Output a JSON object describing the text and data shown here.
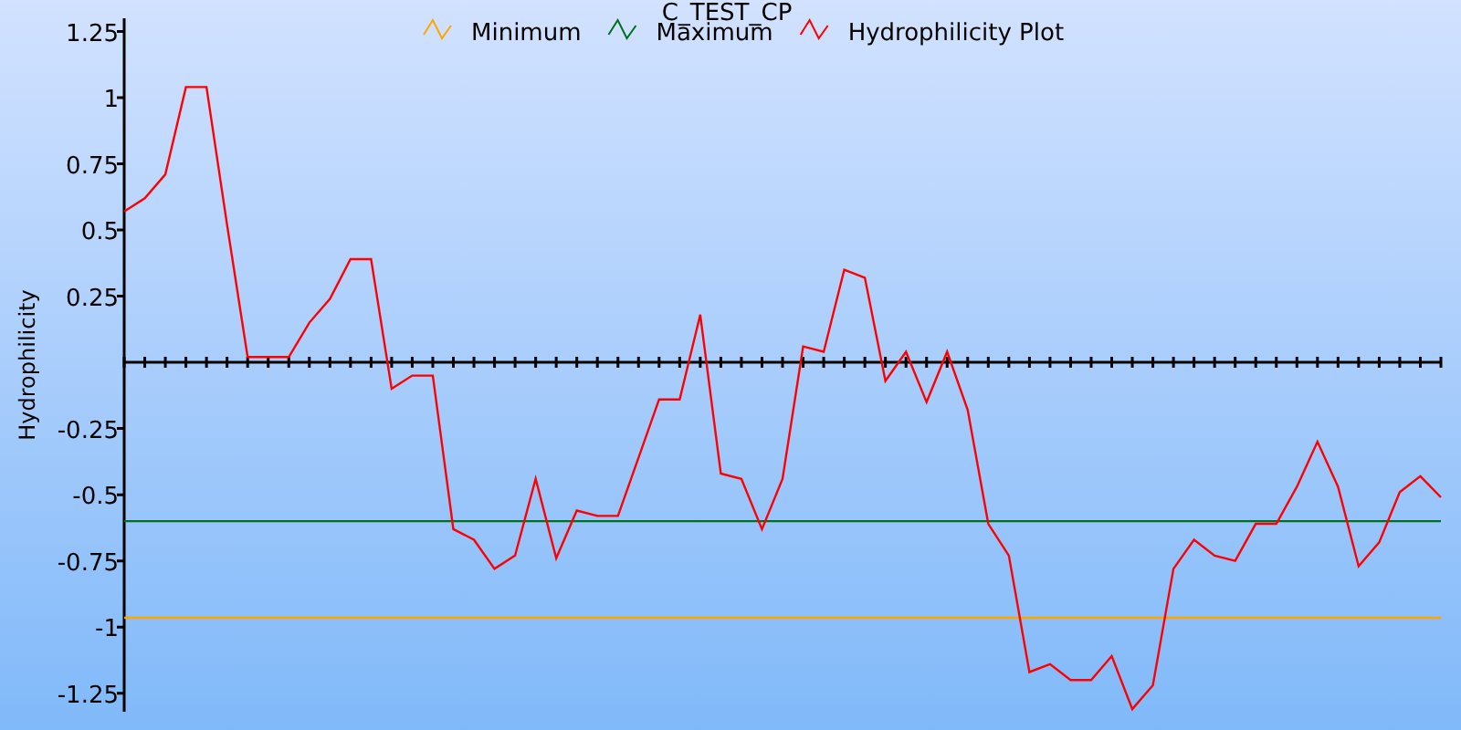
{
  "chart": {
    "chart_data": {
      "type": "line",
      "title": "C_TEST_CP",
      "ylabel": "Hydrophilicity",
      "legend": true,
      "ylim": [
        -1.32,
        1.3
      ],
      "yticks": [
        {
          "value": 1.25,
          "label": "1.25"
        },
        {
          "value": 1,
          "label": "1"
        },
        {
          "value": 0.75,
          "label": "0.75"
        },
        {
          "value": 0.5,
          "label": "0.5"
        },
        {
          "value": 0.25,
          "label": "0.25"
        },
        {
          "value": -0.25,
          "label": "-0.25"
        },
        {
          "value": -0.5,
          "label": "-0.5"
        },
        {
          "value": -0.75,
          "label": "-0.75"
        },
        {
          "value": -1,
          "label": "-1"
        },
        {
          "value": -1.25,
          "label": "-1.25"
        }
      ],
      "series": [
        {
          "name": "Minimum",
          "color": "#ffa500",
          "values": [
            -0.965,
            -0.965,
            -0.965,
            -0.965,
            -0.965,
            -0.965,
            -0.965,
            -0.965,
            -0.965,
            -0.965,
            -0.965,
            -0.965,
            -0.965,
            -0.965,
            -0.965,
            -0.965,
            -0.965,
            -0.965,
            -0.965,
            -0.965,
            -0.965,
            -0.965,
            -0.965,
            -0.965,
            -0.965,
            -0.965,
            -0.965,
            -0.965,
            -0.965,
            -0.965,
            -0.965,
            -0.965,
            -0.965,
            -0.965,
            -0.965,
            -0.965,
            -0.965,
            -0.965,
            -0.965,
            -0.965,
            -0.965,
            -0.965,
            -0.965,
            -0.965,
            -0.965,
            -0.965,
            -0.965,
            -0.965,
            -0.965,
            -0.965,
            -0.965,
            -0.965,
            -0.965,
            -0.965,
            -0.965,
            -0.965,
            -0.965,
            -0.965,
            -0.965,
            -0.965,
            -0.965,
            -0.965,
            -0.965,
            -0.965,
            -0.965
          ]
        },
        {
          "name": "Maximum",
          "color": "#007020",
          "values": [
            -0.6,
            -0.6,
            -0.6,
            -0.6,
            -0.6,
            -0.6,
            -0.6,
            -0.6,
            -0.6,
            -0.6,
            -0.6,
            -0.6,
            -0.6,
            -0.6,
            -0.6,
            -0.6,
            -0.6,
            -0.6,
            -0.6,
            -0.6,
            -0.6,
            -0.6,
            -0.6,
            -0.6,
            -0.6,
            -0.6,
            -0.6,
            -0.6,
            -0.6,
            -0.6,
            -0.6,
            -0.6,
            -0.6,
            -0.6,
            -0.6,
            -0.6,
            -0.6,
            -0.6,
            -0.6,
            -0.6,
            -0.6,
            -0.6,
            -0.6,
            -0.6,
            -0.6,
            -0.6,
            -0.6,
            -0.6,
            -0.6,
            -0.6,
            -0.6,
            -0.6,
            -0.6,
            -0.6,
            -0.6,
            -0.6,
            -0.6,
            -0.6,
            -0.6,
            -0.6,
            -0.6,
            -0.6,
            -0.6,
            -0.6,
            -0.6
          ]
        },
        {
          "name": "Hydrophilicity Plot",
          "color": "#ff0000",
          "values": [
            0.57,
            0.62,
            0.71,
            1.04,
            1.04,
            0.52,
            0.02,
            0.02,
            0.02,
            0.15,
            0.24,
            0.39,
            0.39,
            -0.1,
            -0.05,
            -0.05,
            -0.63,
            -0.67,
            -0.78,
            -0.73,
            -0.44,
            -0.74,
            -0.56,
            -0.58,
            -0.58,
            -0.36,
            -0.14,
            -0.14,
            0.18,
            -0.42,
            -0.44,
            -0.63,
            -0.44,
            0.06,
            0.04,
            0.35,
            0.32,
            -0.07,
            0.04,
            -0.15,
            0.04,
            -0.18,
            -0.61,
            -0.73,
            -1.17,
            -1.14,
            -1.2,
            -1.2,
            -1.11,
            -1.31,
            -1.22,
            -0.78,
            -0.67,
            -0.73,
            -0.75,
            -0.61,
            -0.61,
            -0.47,
            -0.3,
            -0.47,
            -0.77,
            -0.68,
            -0.49,
            -0.43,
            -0.51
          ]
        }
      ]
    }
  }
}
